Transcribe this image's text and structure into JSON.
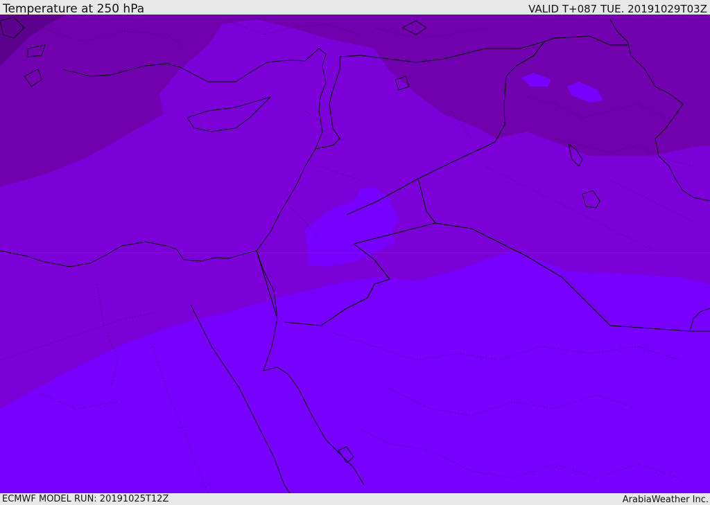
{
  "header": {
    "title": "Temperature at 250 hPa",
    "valid": "VALID T+087 TUE. 20191029T03Z"
  },
  "footer": {
    "model_run": "ECMWF MODEL RUN: 20191025T12Z",
    "credit": "ArabiaWeather Inc."
  },
  "map": {
    "field": "temperature",
    "level": "250 hPa",
    "region": "Eastern Mediterranean and Middle East",
    "color_bands": [
      "#5c008e",
      "#7100ae",
      "#7c00d8",
      "#7800ff"
    ]
  }
}
